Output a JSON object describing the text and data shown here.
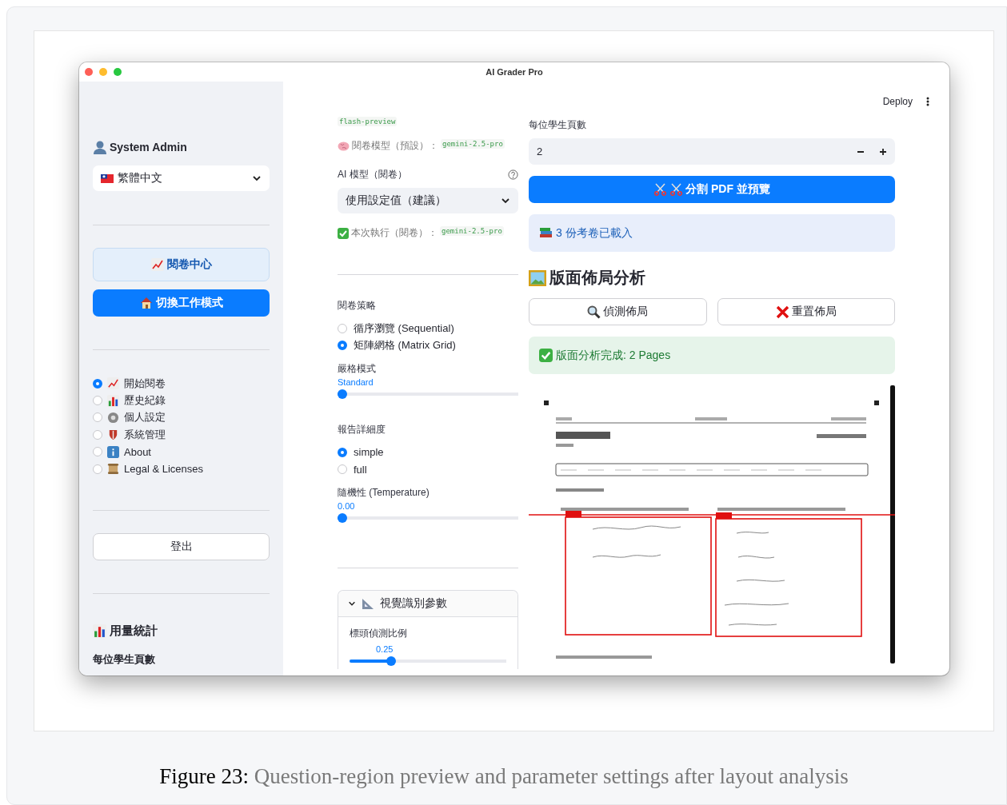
{
  "window": {
    "title": "AI Grader Pro"
  },
  "sidebar": {
    "user": "System Admin",
    "language": "繁體中文",
    "nav_buttons": [
      {
        "label": "閱卷中心",
        "kind": "secondary"
      },
      {
        "label": "切換工作模式",
        "kind": "primary"
      }
    ],
    "menu": [
      {
        "label": "開始閱卷",
        "selected": true
      },
      {
        "label": "歷史紀錄",
        "selected": false
      },
      {
        "label": "個人設定",
        "selected": false
      },
      {
        "label": "系統管理",
        "selected": false
      },
      {
        "label": "About",
        "selected": false
      },
      {
        "label": "Legal & Licenses",
        "selected": false
      }
    ],
    "logout": "登出",
    "usage_title": "用量統計",
    "usage_label": "每位學生頁數"
  },
  "header": {
    "deploy": "Deploy"
  },
  "settings": {
    "cut_code": "flash-preview",
    "default_model": {
      "label": "閱卷模型（預設）：",
      "code": "gemini-2.5-pro"
    },
    "model_select": {
      "label": "AI 模型（閱卷）",
      "value": "使用設定值（建議）"
    },
    "run_model": {
      "label": "本次執行（閱卷）：",
      "code": "gemini-2.5-pro"
    },
    "strategy": {
      "label": "閱卷策略",
      "options": [
        {
          "label": "循序瀏覽 (Sequential)",
          "selected": false
        },
        {
          "label": "矩陣網格 (Matrix Grid)",
          "selected": true
        }
      ]
    },
    "strict": {
      "label": "嚴格模式",
      "value": "Standard",
      "level": 0
    },
    "detail": {
      "label": "報告詳細度",
      "options": [
        {
          "label": "simple",
          "selected": true
        },
        {
          "label": "full",
          "selected": false
        }
      ]
    },
    "temperature": {
      "label": "隨機性 (Temperature)",
      "value": "0.00",
      "level": 0
    },
    "expander": {
      "title": "視覺識別參數",
      "expanded": true,
      "slider": {
        "label": "標頭偵測比例",
        "value": "0.25",
        "level": 0.25
      }
    }
  },
  "workspace": {
    "pages": {
      "label": "每位學生頁數",
      "value": "2"
    },
    "split_button": "分割 PDF 並預覽",
    "info": "3 份考卷已載入",
    "heading": "版面佈局分析",
    "buttons": [
      {
        "label": "偵測佈局",
        "kind": "detect"
      },
      {
        "label": "重置佈局",
        "kind": "reset"
      }
    ],
    "success": "版面分析完成: 2 Pages"
  },
  "caption": {
    "number": "Figure 23:",
    "text": "Question-region preview and parameter settings after layout analysis"
  }
}
